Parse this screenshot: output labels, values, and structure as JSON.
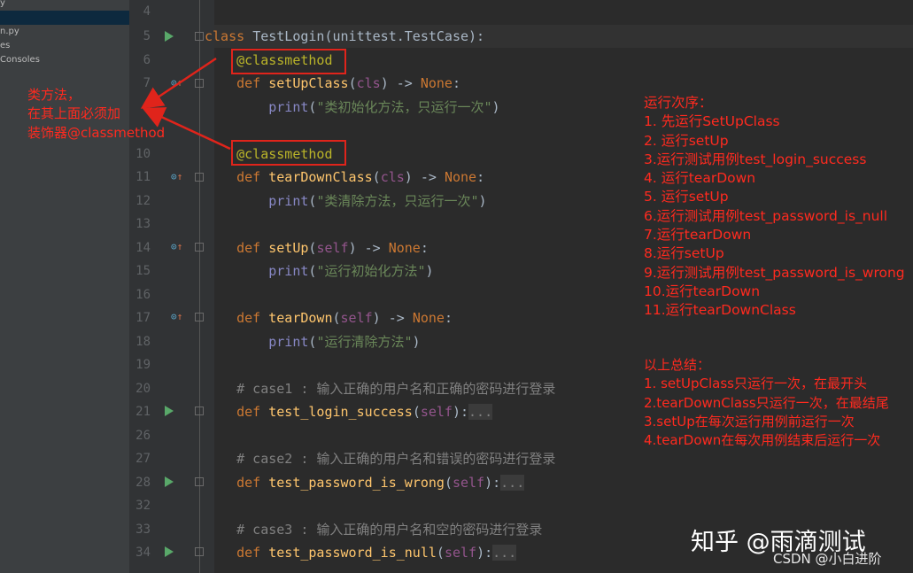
{
  "sidebar": {
    "items": [
      "y",
      "n.py",
      "es",
      "Consoles"
    ]
  },
  "code_lines": [
    {
      "ln": "4",
      "tokens": []
    },
    {
      "ln": "5",
      "tokens": [
        [
          "kw",
          "class "
        ],
        [
          "",
          "TestLogin(unittest.TestCase):"
        ]
      ]
    },
    {
      "ln": "6",
      "tokens": [
        [
          "",
          "    "
        ],
        [
          "dec",
          "@classmethod"
        ]
      ]
    },
    {
      "ln": "7",
      "tokens": [
        [
          "",
          "    "
        ],
        [
          "kw",
          "def "
        ],
        [
          "fn",
          "setUpClass"
        ],
        [
          "",
          "("
        ],
        [
          "sf",
          "cls"
        ],
        [
          "",
          ") -> "
        ],
        [
          "kw",
          "None"
        ],
        [
          "",
          ":"
        ]
      ]
    },
    {
      "ln": "8",
      "tokens": [
        [
          "",
          "        "
        ],
        [
          "bi",
          "print"
        ],
        [
          "",
          "("
        ],
        [
          "st",
          "\"类初始化方法，只运行一次\""
        ],
        [
          "",
          ")"
        ]
      ]
    },
    {
      "ln": "10",
      "tokens": [
        [
          "",
          "    "
        ],
        [
          "dec",
          "@classmethod"
        ]
      ]
    },
    {
      "ln": "11",
      "tokens": [
        [
          "",
          "    "
        ],
        [
          "kw",
          "def "
        ],
        [
          "fn",
          "tearDownClass"
        ],
        [
          "",
          "("
        ],
        [
          "sf",
          "cls"
        ],
        [
          "",
          ") -> "
        ],
        [
          "kw",
          "None"
        ],
        [
          "",
          ":"
        ]
      ]
    },
    {
      "ln": "12",
      "tokens": [
        [
          "",
          "        "
        ],
        [
          "bi",
          "print"
        ],
        [
          "",
          "("
        ],
        [
          "st",
          "\"类清除方法，只运行一次\""
        ],
        [
          "",
          ")"
        ]
      ]
    },
    {
      "ln": "13",
      "tokens": []
    },
    {
      "ln": "14",
      "tokens": [
        [
          "",
          "    "
        ],
        [
          "kw",
          "def "
        ],
        [
          "fn",
          "setUp"
        ],
        [
          "",
          "("
        ],
        [
          "sf",
          "self"
        ],
        [
          "",
          ") -> "
        ],
        [
          "kw",
          "None"
        ],
        [
          "",
          ":"
        ]
      ]
    },
    {
      "ln": "15",
      "tokens": [
        [
          "",
          "        "
        ],
        [
          "bi",
          "print"
        ],
        [
          "",
          "("
        ],
        [
          "st",
          "\"运行初始化方法\""
        ],
        [
          "",
          ")"
        ]
      ]
    },
    {
      "ln": "16",
      "tokens": []
    },
    {
      "ln": "17",
      "tokens": [
        [
          "",
          "    "
        ],
        [
          "kw",
          "def "
        ],
        [
          "fn",
          "tearDown"
        ],
        [
          "",
          "("
        ],
        [
          "sf",
          "self"
        ],
        [
          "",
          ") -> "
        ],
        [
          "kw",
          "None"
        ],
        [
          "",
          ":"
        ]
      ]
    },
    {
      "ln": "18",
      "tokens": [
        [
          "",
          "        "
        ],
        [
          "bi",
          "print"
        ],
        [
          "",
          "("
        ],
        [
          "st",
          "\"运行清除方法\""
        ],
        [
          "",
          ")"
        ]
      ]
    },
    {
      "ln": "19",
      "tokens": []
    },
    {
      "ln": "20",
      "tokens": [
        [
          "",
          "    "
        ],
        [
          "cm",
          "# case1 : 输入正确的用户名和正确的密码进行登录"
        ]
      ]
    },
    {
      "ln": "21",
      "tokens": [
        [
          "",
          "    "
        ],
        [
          "kw",
          "def "
        ],
        [
          "fn",
          "test_login_success"
        ],
        [
          "",
          "("
        ],
        [
          "sf",
          "self"
        ],
        [
          "",
          "):"
        ],
        [
          "fold",
          "..."
        ]
      ]
    },
    {
      "ln": "26",
      "tokens": []
    },
    {
      "ln": "27",
      "tokens": [
        [
          "",
          "    "
        ],
        [
          "cm",
          "# case2 : 输入正确的用户名和错误的密码进行登录"
        ]
      ]
    },
    {
      "ln": "28",
      "tokens": [
        [
          "",
          "    "
        ],
        [
          "kw",
          "def "
        ],
        [
          "fn",
          "test_password_is_wrong"
        ],
        [
          "",
          "("
        ],
        [
          "sf",
          "self"
        ],
        [
          "",
          "):"
        ],
        [
          "fold",
          "..."
        ]
      ]
    },
    {
      "ln": "32",
      "tokens": []
    },
    {
      "ln": "33",
      "tokens": [
        [
          "",
          "    "
        ],
        [
          "cm",
          "# case3 : 输入正确的用户名和空的密码进行登录"
        ]
      ]
    },
    {
      "ln": "34",
      "tokens": [
        [
          "",
          "    "
        ],
        [
          "kw",
          "def "
        ],
        [
          "fn",
          "test_password_is_null"
        ],
        [
          "",
          "("
        ],
        [
          "sf",
          "self"
        ],
        [
          "",
          "):"
        ],
        [
          "fold",
          "..."
        ]
      ]
    }
  ],
  "annotation_left": [
    "类方法，",
    "在其上面必须加",
    "装饰器@classmethod"
  ],
  "run_order": {
    "heading": "运行次序：",
    "steps": [
      "1. 先运行SetUpClass",
      "2. 运行setUp",
      "3.运行测试用例test_login_success",
      "4. 运行tearDown",
      "5. 运行setUp",
      "6.运行测试用例test_password_is_null",
      "7.运行tearDown",
      "8.运行setUp",
      "9.运行测试用例test_password_is_wrong",
      "10.运行tearDown",
      "11.运行tearDownClass"
    ]
  },
  "summary": {
    "heading": "以上总结：",
    "items": [
      "1. setUpClass只运行一次，在最开头",
      "2.tearDownClass只运行一次，在最结尾",
      "3.setUp在每次运行用例前运行一次",
      "4.tearDown在每次用例结束后运行一次"
    ]
  },
  "watermark": {
    "zhihu": "知乎 @雨滴测试",
    "csdn": "CSDN @小白进阶"
  },
  "colors": {
    "annotation": "#ff2a1f",
    "editor_bg": "#2b2b2b"
  }
}
